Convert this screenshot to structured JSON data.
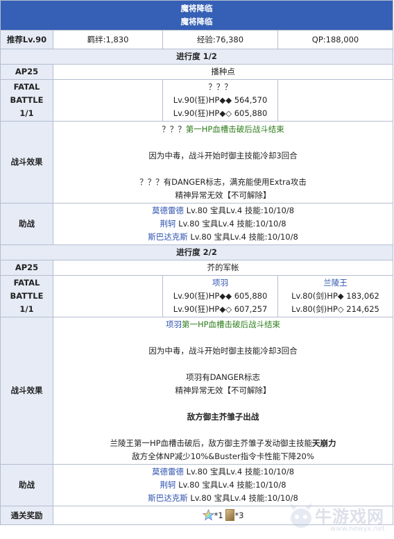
{
  "header": {
    "title": "魔将降临",
    "subtitle": "魔将降临"
  },
  "summary": {
    "level_label": "推荐Lv.90",
    "bond": "羁绊:1,830",
    "exp": "经验:76,380",
    "qp": "QP:188,000"
  },
  "stage1": {
    "progress": "进行度 1/2",
    "ap": "AP25",
    "location": "播种点",
    "fatal_label": [
      "FATAL",
      "BATTLE",
      "1/1"
    ],
    "enemy_name": "？？？",
    "enemy_hp1": "Lv.90(狂)HP◆◆ 564,570",
    "enemy_hp2": "Lv.90(狂)HP◆◇ 605,880",
    "effects_label": "战斗效果",
    "effect_head": "？？？",
    "effect_green": "第一HP血槽击破后战斗结束",
    "effect2": "因为中毒，战斗开始时御主技能冷却3回合",
    "effect3": "？？？有DANGER标志，满充能使用Extra攻击",
    "effect4": "精神异常无效【不可解除】",
    "support_label": "助战",
    "support": [
      {
        "name": "莫德雷德",
        "detail": " Lv.80 宝具Lv.4 技能:10/10/8"
      },
      {
        "name": "荆轲",
        "detail": " Lv.80 宝具Lv.4 技能:10/10/8"
      },
      {
        "name": "斯巴达克斯",
        "detail": " Lv.80 宝具Lv.4 技能:10/10/8"
      }
    ]
  },
  "stage2": {
    "progress": "进行度 2/2",
    "ap": "AP25",
    "location": "芥的军帐",
    "fatal_label": [
      "FATAL",
      "BATTLE",
      "1/1"
    ],
    "enemy1_name": "项羽",
    "enemy1_hp1": "Lv.90(狂)HP◆◆ 605,880",
    "enemy1_hp2": "Lv.90(狂)HP◆◇ 607,257",
    "enemy2_name": "兰陵王",
    "enemy2_hp1": "Lv.80(剑)HP◆ 183,062",
    "enemy2_hp2": "Lv.80(剑)HP◇ 214,625",
    "effects_label": "战斗效果",
    "effect_head": "项羽",
    "effect_green": "第一HP血槽击破后战斗结束",
    "effect2": "因为中毒，战斗开始时御主技能冷却3回合",
    "effect3": "项羽有DANGER标志",
    "effect4": "精神异常无效【不可解除】",
    "effect5": "敌方御主芥雏子出战",
    "effect6_pre": "兰陵王第一HP血槽击破后，敌方御主芥雏子发动御主技能",
    "effect6_bold": "天崩力",
    "effect7": "敌方全体NP减少10%&Buster指令卡性能下降20%",
    "support_label": "助战",
    "support": [
      {
        "name": "莫德雷德",
        "detail": " Lv.80 宝具Lv.4 技能:10/10/8"
      },
      {
        "name": "荆轲",
        "detail": " Lv.80 宝具Lv.4 技能:10/10/8"
      },
      {
        "name": "斯巴达克斯",
        "detail": " Lv.80 宝具Lv.4 技能:10/10/8"
      }
    ]
  },
  "reward": {
    "label": "通关奖励",
    "item1_count": "*1",
    "item2_count": "*3",
    "item1_icon": "rainbow-star-icon",
    "item2_icon": "craft-essence-card-icon"
  },
  "watermark": {
    "text": "牛游戏网",
    "url": "www.newyx.net"
  },
  "colors": {
    "header_bg": "#3660b5",
    "label_bg": "#e6ebf5",
    "link_blue": "#2d52b0",
    "green": "#2e7d1b",
    "border": "#b4bdd0"
  }
}
